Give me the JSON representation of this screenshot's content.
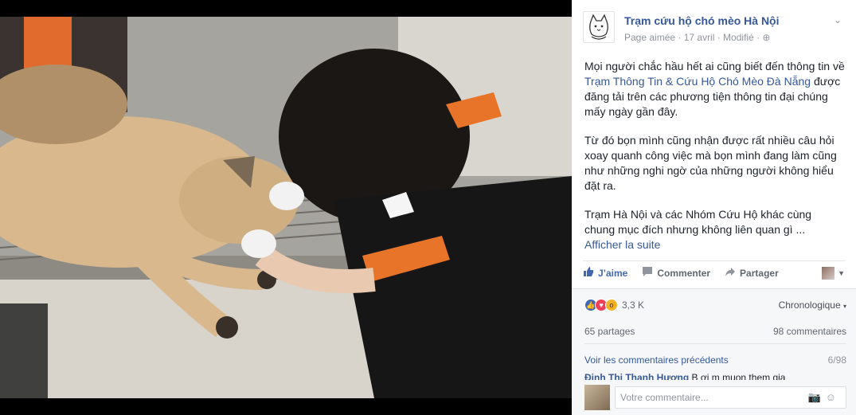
{
  "post": {
    "page_name": "Trạm cứu hộ chó mèo Hà Nội",
    "meta": "Page aimée · 17 avril · Modifié ·",
    "para1_prefix": "Mọi người chắc hầu hết ai cũng biết đến thông tin về ",
    "para1_link": "Trạm Thông Tin & Cứu Hộ Chó Mèo Đà Nẵng",
    "para1_suffix": " được đăng tải trên các phương tiện thông tin đại chúng mấy ngày gần đây.",
    "para2": "Từ đó bọn mình cũng nhận được rất nhiều câu hỏi xoay quanh công việc mà bọn mình đang làm cũng như những nghi ngờ của những người không hiểu đặt ra.",
    "para3": "Trạm Hà Nội và các Nhóm Cứu Hộ khác cùng chung mục đích nhưng không liên quan gì ...",
    "see_more": "Afficher la suite"
  },
  "actions": {
    "like": "J’aime",
    "comment": "Commenter",
    "share": "Partager"
  },
  "reactions": {
    "count": "3,3 K",
    "sort": "Chronologique"
  },
  "stats": {
    "shares": "65 partages",
    "comments": "98 commentaires"
  },
  "comments": {
    "previous": "Voir les commentaires précédents",
    "page": "6/98",
    "partial_author": "Đinh Thị Thanh Hương",
    "partial_text": "B ơi m muon them gia",
    "placeholder": "Votre commentaire..."
  },
  "colors": {
    "link": "#365899",
    "like_blue": "#4267b2",
    "love": "#f33e58",
    "wow": "#f7b125"
  },
  "icons": [
    "cat-avatar-icon",
    "chevron-down-icon",
    "globe-icon",
    "like-icon",
    "comment-icon",
    "share-icon",
    "camera-icon",
    "smiley-icon"
  ]
}
